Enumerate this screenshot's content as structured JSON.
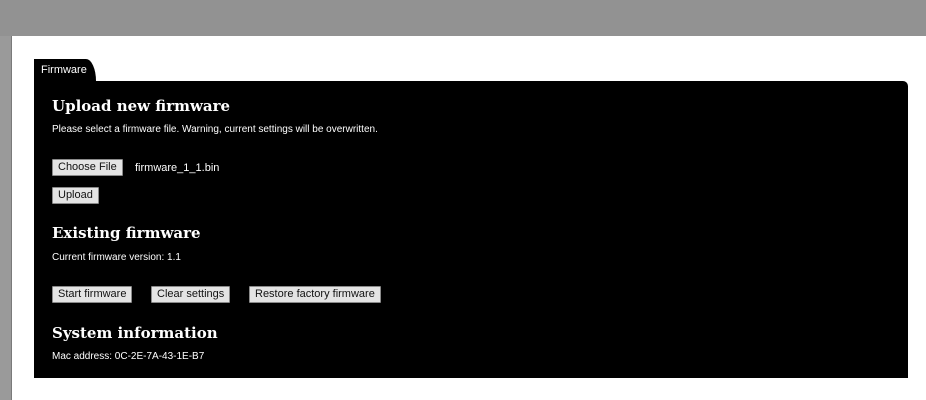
{
  "tab": {
    "label": "Firmware"
  },
  "upload": {
    "heading": "Upload new firmware",
    "description": "Please select a firmware file. Warning, current settings will be overwritten.",
    "choose_file_label": "Choose File",
    "selected_file": "firmware_1_1.bin",
    "upload_label": "Upload"
  },
  "existing": {
    "heading": "Existing firmware",
    "version_text": "Current firmware version: 1.1",
    "start_label": "Start firmware",
    "clear_label": "Clear settings",
    "restore_label": "Restore factory firmware"
  },
  "system": {
    "heading": "System information",
    "mac_text": "Mac address: 0C-2E-7A-43-1E-B7"
  }
}
